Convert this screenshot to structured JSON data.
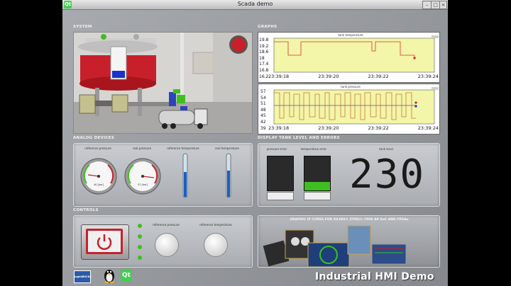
{
  "window": {
    "title": "Scada demo",
    "qt_badge": "Qt"
  },
  "sections": {
    "system": "SYSTEM",
    "graphs": "GRAPHS",
    "analog": "ANALOG DEVICES",
    "display": "DISPLAY TANK LEVEL AND ERRORS",
    "controls": "CONTROLS"
  },
  "graphs": {
    "top": {
      "title": "tank temperature",
      "y_ticks": [
        "19.8",
        "19.2",
        "18.6",
        "18",
        "17.4",
        "16.8",
        "16.2"
      ],
      "x_ticks": [
        "23:39:18",
        "23:39:20",
        "23:39:22",
        "23:39:24"
      ]
    },
    "bottom": {
      "title": "tank pressure",
      "y_ticks": [
        "57",
        "54",
        "51",
        "48",
        "45",
        "42",
        "39"
      ],
      "x_ticks": [
        "23:39:18",
        "23:39:20",
        "23:39:22",
        "23:39:24"
      ]
    }
  },
  "analog": {
    "gauge1_label": "reference pressure",
    "gauge1_unit": "40 [bar]",
    "gauge2_label": "real pressure",
    "gauge2_unit": "57 [bar]",
    "therm1_label": "reference temperature",
    "therm2_label": "real temperature"
  },
  "display": {
    "pressure_error": "pressure error",
    "temperature_error": "temperature error",
    "tank_level": "tank level",
    "tank_level_value": "230"
  },
  "controls": {
    "knob1_label": "reference pressure",
    "knob2_label": "reference temperature"
  },
  "promo": {
    "caption": "GRAPHIC IP CORES FOR XILINX® ZYNQ®-7000 AP SoC AND FPGAs",
    "footer": "Industrial HMI Demo"
  },
  "logos": {
    "logicbricks": "logicBRICKS",
    "qt": "Qt"
  },
  "colors": {
    "tank_red": "#c8202a",
    "graph_yellow": "#f3f5a8",
    "ok_green": "#3fbf1f"
  }
}
